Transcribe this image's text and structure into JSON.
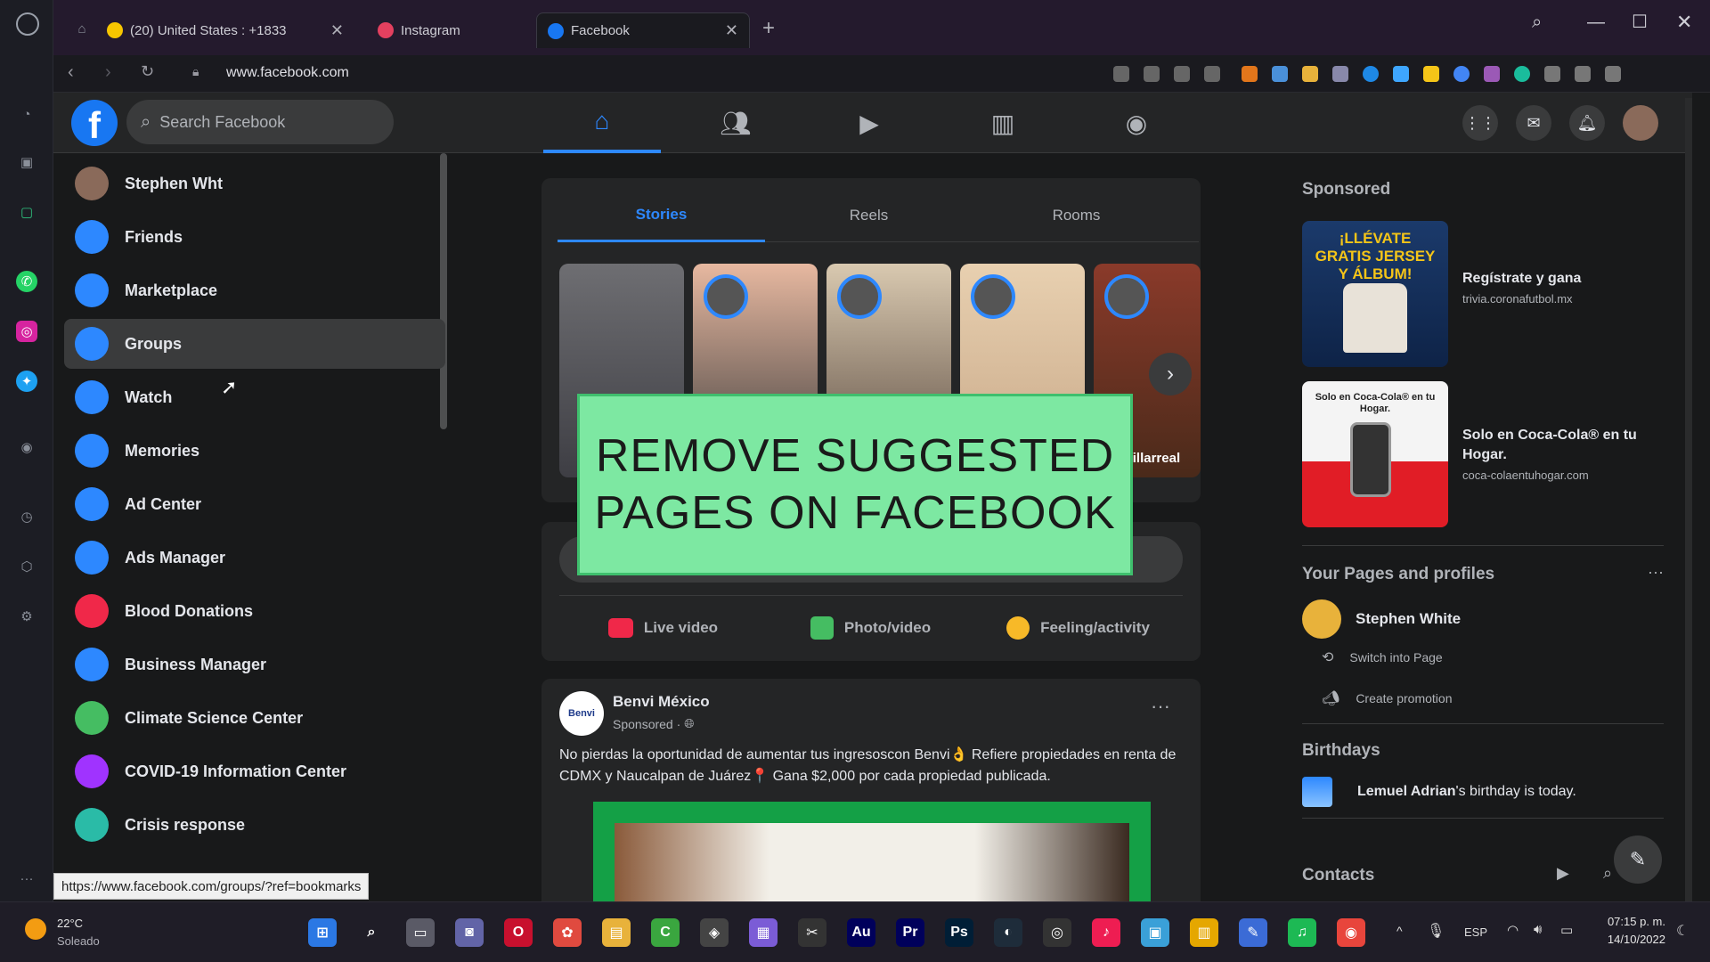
{
  "browser": {
    "tabs": [
      {
        "label": "(20) United States : +1833",
        "color": "#f7c600"
      },
      {
        "label": "Instagram",
        "color": "#e4405f"
      },
      {
        "label": "Facebook",
        "color": "#1877f2"
      }
    ],
    "url": "www.facebook.com",
    "status_url": "https://www.facebook.com/groups/?ref=bookmarks"
  },
  "header": {
    "search_placeholder": "Search Facebook",
    "nav_icons": [
      "home-icon",
      "friends-icon",
      "watch-icon",
      "marketplace-icon",
      "groups-icon"
    ],
    "right_icons": [
      "menu-grid-icon",
      "messenger-icon",
      "bell-icon",
      "avatar"
    ]
  },
  "sidebar": {
    "items": [
      {
        "label": "Stephen Wht",
        "icon": "avatar",
        "color": "#8a6a5a"
      },
      {
        "label": "Friends",
        "icon": "friends-icon",
        "color": "#2d88ff"
      },
      {
        "label": "Marketplace",
        "icon": "marketplace-icon",
        "color": "#2d88ff"
      },
      {
        "label": "Groups",
        "icon": "groups-icon",
        "color": "#2d88ff"
      },
      {
        "label": "Watch",
        "icon": "watch-icon",
        "color": "#2d88ff"
      },
      {
        "label": "Memories",
        "icon": "clock-icon",
        "color": "#2d88ff"
      },
      {
        "label": "Ad Center",
        "icon": "megaphone-icon",
        "color": "#2d88ff"
      },
      {
        "label": "Ads Manager",
        "icon": "bar-chart-icon",
        "color": "#2d88ff"
      },
      {
        "label": "Blood Donations",
        "icon": "blood-drop-icon",
        "color": "#f02849"
      },
      {
        "label": "Business Manager",
        "icon": "business-icon",
        "color": "#2d88ff"
      },
      {
        "label": "Climate Science Center",
        "icon": "leaf-icon",
        "color": "#45bd62"
      },
      {
        "label": "COVID-19 Information Center",
        "icon": "heart-icon",
        "color": "#a033ff"
      },
      {
        "label": "Crisis response",
        "icon": "crisis-icon",
        "color": "#2abba7"
      }
    ],
    "active_index": 3
  },
  "feed": {
    "tabs": [
      "Stories",
      "Reels",
      "Rooms"
    ],
    "story_caption": "Villarreal",
    "overlay_text_1": "REMOVE SUGGESTED",
    "overlay_text_2": "PAGES ON FACEBOOK",
    "composer_actions": [
      {
        "label": "Live video",
        "icon": "live-video-icon",
        "color": "#f02849"
      },
      {
        "label": "Photo/video",
        "icon": "photo-icon",
        "color": "#45bd62"
      },
      {
        "label": "Feeling/activity",
        "icon": "feeling-icon",
        "color": "#f7b928"
      }
    ],
    "post": {
      "author": "Benvi México",
      "avatar_text": "Benvi",
      "meta": "Sponsored ·",
      "text": "No pierdas la oportunidad de aumentar tus ingresoscon Benvi👌 Refiere propiedades en renta de CDMX y Naucalpan de Juárez📍 Gana $2,000 por cada propiedad publicada.",
      "more": "···"
    }
  },
  "right": {
    "sponsored_title": "Sponsored",
    "ads": [
      {
        "title": "Regístrate y gana",
        "domain": "trivia.coronafutbol.mx",
        "image_text": "¡LLÉVATE GRATIS JERSEY Y ÁLBUM!"
      },
      {
        "title": "Solo en Coca-Cola® en tu Hogar.",
        "domain": "coca-colaentuhogar.com",
        "image_text": "Solo en Coca-Cola® en tu Hogar."
      }
    ],
    "pages_title": "Your Pages and profiles",
    "pages_more": "···",
    "page_name": "Stephen White",
    "page_actions": [
      "Switch into Page",
      "Create promotion"
    ],
    "birthdays_title": "Birthdays",
    "birthday_name": "Lemuel Adrian",
    "birthday_rest": "'s birthday is today.",
    "contacts_title": "Contacts"
  },
  "taskbar": {
    "weather_temp": "22°C",
    "weather_desc": "Soleado",
    "lang": "ESP",
    "time": "07:15 p. m.",
    "date": "14/10/2022",
    "apps": [
      {
        "label": "⊞",
        "color": "#2b78e4"
      },
      {
        "label": "⌕",
        "color": "transparent"
      },
      {
        "label": "▭",
        "color": "#5a5a66"
      },
      {
        "label": "◙",
        "color": "#6264a7"
      },
      {
        "label": "O",
        "color": "#c8102e"
      },
      {
        "label": "✿",
        "color": "#e04a3f"
      },
      {
        "label": "▤",
        "color": "#e8b23b"
      },
      {
        "label": "C",
        "color": "#3aa63f"
      },
      {
        "label": "◈",
        "color": "#444"
      },
      {
        "label": "▦",
        "color": "#7b5cd6"
      },
      {
        "label": "✂",
        "color": "#333"
      },
      {
        "label": "Au",
        "color": "#00005b"
      },
      {
        "label": "Pr",
        "color": "#00005b"
      },
      {
        "label": "Ps",
        "color": "#001e36"
      },
      {
        "label": "◐",
        "color": "#1e2c3a"
      },
      {
        "label": "◎",
        "color": "#333"
      },
      {
        "label": "♪",
        "color": "#ee1d52"
      },
      {
        "label": "▣",
        "color": "#3aa0d8"
      },
      {
        "label": "▥",
        "color": "#e5a700"
      },
      {
        "label": "✎",
        "color": "#3b6bd6"
      },
      {
        "label": "♫",
        "color": "#1db954"
      },
      {
        "label": "◉",
        "color": "#e8453c"
      }
    ]
  }
}
